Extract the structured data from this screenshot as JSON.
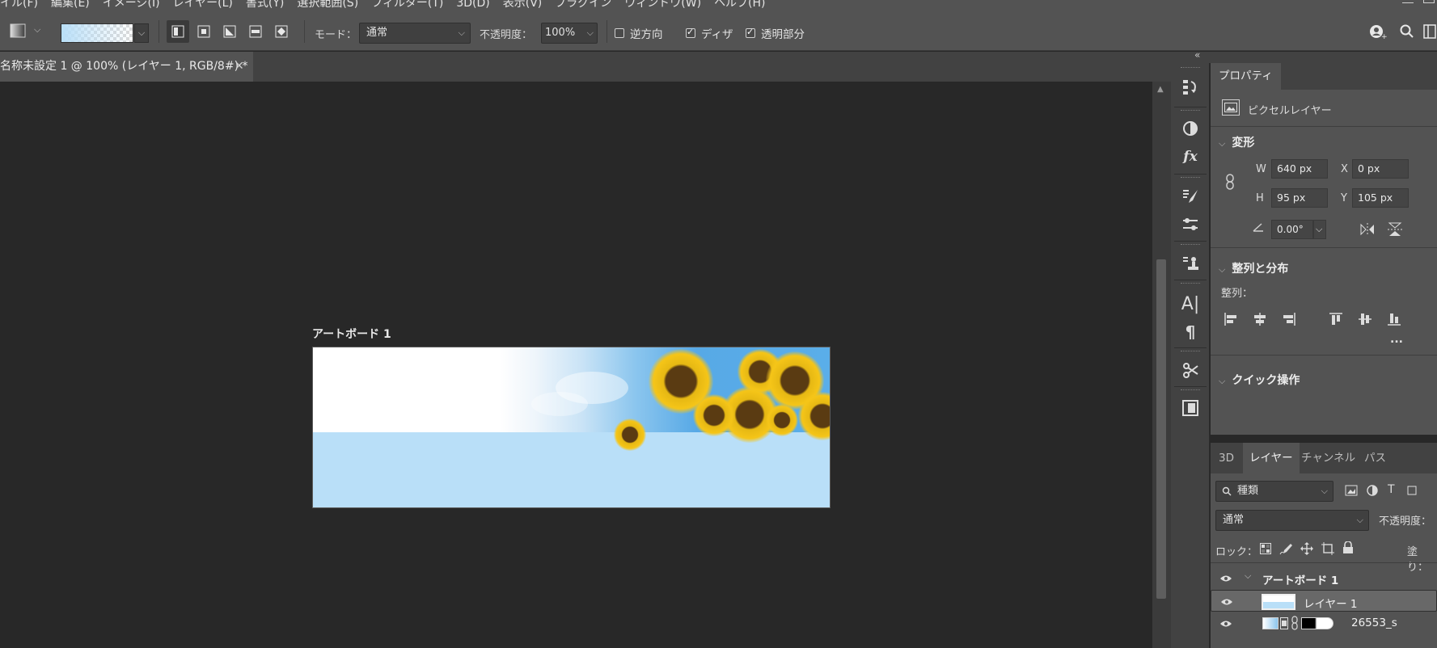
{
  "menu": {
    "items": [
      "イル(F)",
      "編集(E)",
      "イメージ(I)",
      "レイヤー(L)",
      "書式(Y)",
      "選択範囲(S)",
      "フィルター(T)",
      "3D(D)",
      "表示(V)",
      "プラグイン",
      "ウィンドウ(W)",
      "ヘルプ(H)"
    ]
  },
  "options_bar": {
    "mode_label": "モード：",
    "mode_value": "通常",
    "opacity_label": "不透明度：",
    "opacity_value": "100%",
    "reverse_label": "逆方向",
    "reverse_checked": false,
    "dither_label": "ディザ",
    "dither_checked": true,
    "transparency_label": "透明部分",
    "transparency_checked": true,
    "gradient_type_icons": [
      "linear-gradient-icon",
      "radial-gradient-icon",
      "angle-gradient-icon",
      "reflected-gradient-icon",
      "diamond-gradient-icon"
    ]
  },
  "document": {
    "tab_title": "名称未設定 1 @ 100% (レイヤー 1, RGB/8#) *",
    "artboard_label": "アートボード 1",
    "band_color": "#b9dff8"
  },
  "properties": {
    "tab": "プロパティ",
    "layer_kind": "ピクセルレイヤー",
    "transform_title": "変形",
    "w_label": "W",
    "w_value": "640 px",
    "x_label": "X",
    "x_value": "0 px",
    "h_label": "H",
    "h_value": "95 px",
    "y_label": "Y",
    "y_value": "105 px",
    "angle_value": "0.00°",
    "align_title": "整列と分布",
    "align_label": "整列：",
    "quick_title": "クイック操作",
    "more": "..."
  },
  "layers": {
    "tabs": [
      "3D",
      "レイヤー",
      "チャンネル",
      "パス"
    ],
    "active_tab": "レイヤー",
    "filter_value": "種類",
    "blend_value": "通常",
    "opacity_label": "不透明度：",
    "lock_label": "ロック：",
    "fill_label": "塗り：",
    "rows": [
      {
        "name": "アートボード 1"
      },
      {
        "name": "レイヤー 1"
      },
      {
        "name": "26553_s"
      }
    ]
  }
}
